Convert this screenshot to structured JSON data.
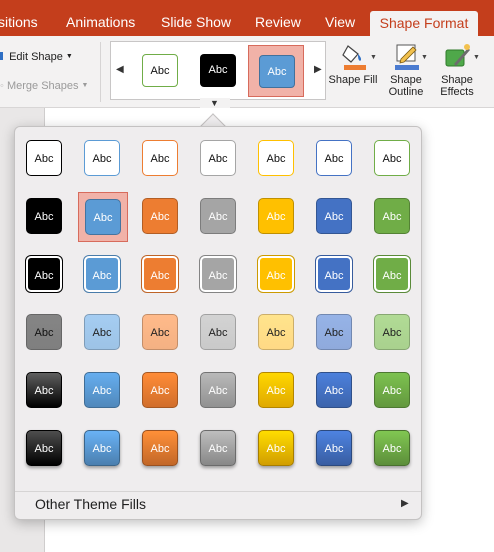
{
  "ribbon": {
    "tabs": [
      {
        "label": "sitions",
        "active": false
      },
      {
        "label": "Animations",
        "active": false
      },
      {
        "label": "Slide Show",
        "active": false
      },
      {
        "label": "Review",
        "active": false
      },
      {
        "label": "View",
        "active": false
      },
      {
        "label": "Shape Format",
        "active": true
      }
    ],
    "edit_shape": "Edit Shape",
    "merge_shapes": "Merge Shapes",
    "gallery": [
      {
        "label": "Abc",
        "style": "outline",
        "color": "#70ad47",
        "selected": false
      },
      {
        "label": "Abc",
        "style": "solid",
        "color": "#000000",
        "selected": false
      },
      {
        "label": "Abc",
        "style": "solid",
        "color": "#5b9bd5",
        "selected": true
      }
    ],
    "shape_fill": "Shape Fill",
    "shape_outline": "Shape Outline",
    "shape_effects": "Shape Effects"
  },
  "panel": {
    "swatch_label": "Abc",
    "colors": [
      "#000000",
      "#5b9bd5",
      "#ed7d31",
      "#a5a5a5",
      "#ffc000",
      "#4472c4",
      "#70ad47"
    ],
    "light_colors": [
      "#7f7f7f",
      "#9dc3e6",
      "#f4b183",
      "#c9c9c9",
      "#ffd985",
      "#8faadc",
      "#a9d18e"
    ],
    "rows": [
      "outline",
      "solid",
      "solid-bordered",
      "light",
      "gradient",
      "gradient-raised"
    ],
    "selected": {
      "row": 1,
      "col": 1
    },
    "other_theme_fills": "Other Theme Fills"
  }
}
